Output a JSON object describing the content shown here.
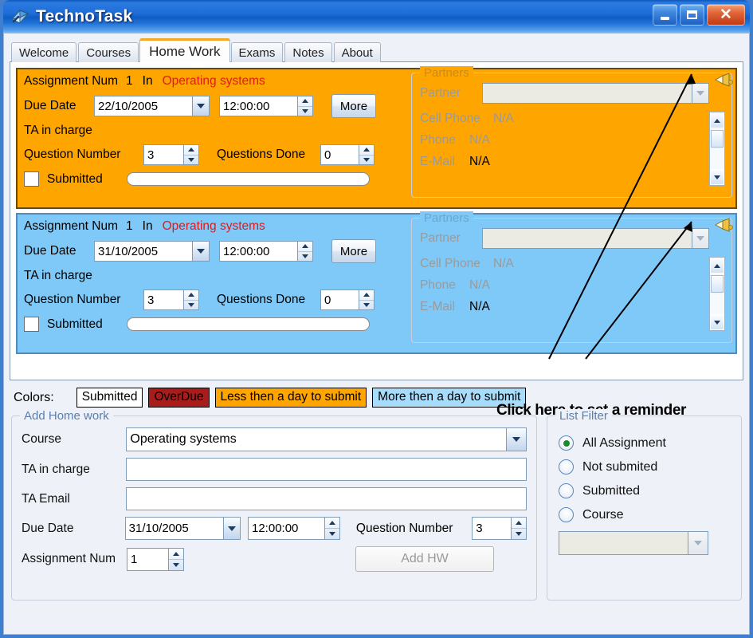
{
  "window": {
    "title": "TechnoTask",
    "icon": "app-book-icon",
    "buttons": {
      "minimize": "minimize",
      "maximize": "maximize",
      "close": "close"
    }
  },
  "tabs": [
    {
      "label": "Welcome",
      "active": false
    },
    {
      "label": "Courses",
      "active": false
    },
    {
      "label": "Home Work",
      "active": true
    },
    {
      "label": "Exams",
      "active": false
    },
    {
      "label": "Notes",
      "active": false
    },
    {
      "label": "About",
      "active": false
    }
  ],
  "assignments": [
    {
      "color": "orange",
      "color_hex": "#FFA500",
      "assignment_num_label": "Assignment Num",
      "assignment_num": "1",
      "in_label": "In",
      "course": "Operating systems",
      "due_date_label": "Due Date",
      "due_date": "22/10/2005",
      "due_time": "12:00:00",
      "more_label": "More",
      "ta_label": "TA in charge",
      "ta_value": "",
      "question_number_label": "Question Number",
      "question_number": "3",
      "questions_done_label": "Questions Done",
      "questions_done": "0",
      "submitted_label": "Submitted",
      "submitted_checked": false,
      "progress_percent": 0,
      "partners": {
        "group_title": "Partners",
        "partner_label": "Partner",
        "partner_value": "",
        "cell_phone_label": "Cell Phone",
        "cell_phone_value": "N/A",
        "phone_label": "Phone",
        "phone_value": "N/A",
        "email_label": "E-Mail",
        "email_value": "N/A"
      },
      "reminder_icon": "reminder-horn-icon"
    },
    {
      "color": "blue",
      "color_hex": "#7FC9F8",
      "assignment_num_label": "Assignment Num",
      "assignment_num": "1",
      "in_label": "In",
      "course": "Operating systems",
      "due_date_label": "Due Date",
      "due_date": "31/10/2005",
      "due_time": "12:00:00",
      "more_label": "More",
      "ta_label": "TA in charge",
      "ta_value": "",
      "question_number_label": "Question Number",
      "question_number": "3",
      "questions_done_label": "Questions Done",
      "questions_done": "0",
      "submitted_label": "Submitted",
      "submitted_checked": false,
      "progress_percent": 0,
      "partners": {
        "group_title": "Partners",
        "partner_label": "Partner",
        "partner_value": "",
        "cell_phone_label": "Cell Phone",
        "cell_phone_value": "N/A",
        "phone_label": "Phone",
        "phone_value": "N/A",
        "email_label": "E-Mail",
        "email_value": "N/A"
      },
      "reminder_icon": "reminder-horn-icon"
    }
  ],
  "annotation": {
    "text": "Click here to set a reminder"
  },
  "legend": {
    "label": "Colors:",
    "items": [
      {
        "text": "Submitted",
        "bg": "#FFFFFF",
        "fg": "#000000"
      },
      {
        "text": "OverDue",
        "bg": "#A81C1C",
        "fg": "#000000"
      },
      {
        "text": "Less then a day to submit",
        "bg": "#FFA500",
        "fg": "#000000"
      },
      {
        "text": "More then a day to submit",
        "bg": "#A8DCFB",
        "fg": "#000000"
      }
    ]
  },
  "add_homework": {
    "group_title": "Add Home work",
    "course_label": "Course",
    "course_value": "Operating systems",
    "ta_label": "TA in charge",
    "ta_value": "",
    "ta_email_label": "TA Email",
    "ta_email_value": "",
    "due_date_label": "Due Date",
    "due_date": "31/10/2005",
    "due_time": "12:00:00",
    "question_number_label": "Question Number",
    "question_number": "3",
    "assignment_num_label": "Assignment Num",
    "assignment_num": "1",
    "add_button": "Add HW"
  },
  "list_filter": {
    "group_title": "List Filter",
    "options": [
      {
        "label": "All Assignment",
        "selected": true
      },
      {
        "label": "Not submited",
        "selected": false
      },
      {
        "label": "Submitted",
        "selected": false
      },
      {
        "label": "Course",
        "selected": false
      }
    ],
    "course_combo_value": ""
  }
}
